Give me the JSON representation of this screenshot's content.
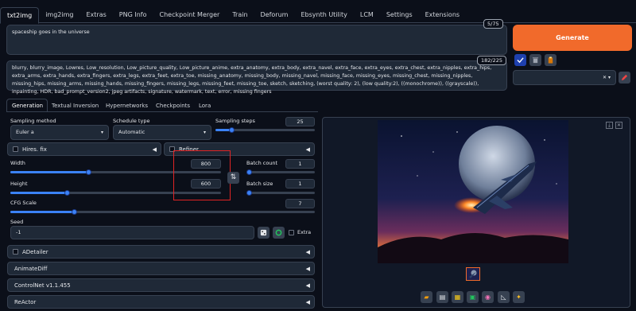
{
  "topnav": [
    "txt2img",
    "img2img",
    "Extras",
    "PNG Info",
    "Checkpoint Merger",
    "Train",
    "Deforum",
    "Ebsynth Utility",
    "LCM",
    "Settings",
    "Extensions"
  ],
  "prompt": {
    "text": "spaceship goes in the universe",
    "counter": "5/75"
  },
  "negative_prompt": {
    "text": "blurry, blurry_image, Lowres, Low_resolution, Low_picture_quality, Low_picture_anime, extra_anatomy, extra_body, extra_navel, extra_face, extra_eyes, extra_chest, extra_nipples, extra_hips, extra_arms, extra_hands, extra_fingers, extra_legs, extra_feet, extra_toe, missing_anatomy, missing_body, missing_navel, missing_face, missing_eyes, missing_chest, missing_nipples, missing_hips, missing_arms, missing_hands, missing_fingers, missing_legs, missing_feet, missing_toe, sketch, sketching, (worst quality: 2), (low quality:2), ((monochrome)), ((grayscale)), inpainting, HDR, bad_prompt_version2, jpeg artifacts, signature, watermark, text, error, missing fingers",
    "counter": "182/225"
  },
  "generate_label": "Generate",
  "subtabs": [
    "Generation",
    "Textual Inversion",
    "Hypernetworks",
    "Checkpoints",
    "Lora"
  ],
  "sampling_method": {
    "label": "Sampling method",
    "value": "Euler a"
  },
  "schedule_type": {
    "label": "Schedule type",
    "value": "Automatic"
  },
  "sampling_steps": {
    "label": "Sampling steps",
    "value": "25",
    "fraction": 0.16
  },
  "hires_label": "Hires. fix",
  "refiner_label": "Refiner",
  "width": {
    "label": "Width",
    "value": "800",
    "fraction": 0.37
  },
  "height": {
    "label": "Height",
    "value": "600",
    "fraction": 0.27
  },
  "batch_count": {
    "label": "Batch count",
    "value": "1",
    "fraction": 0.0
  },
  "batch_size": {
    "label": "Batch size",
    "value": "1",
    "fraction": 0.0
  },
  "cfg_scale": {
    "label": "CFG Scale",
    "value": "7",
    "fraction": 0.21
  },
  "seed": {
    "label": "Seed",
    "value": "-1",
    "extra_label": "Extra"
  },
  "accordions": [
    "ADetailer",
    "AnimateDiff",
    "ControlNet v1.1.455",
    "ReActor"
  ],
  "swap_icon": "⇅",
  "colors": {
    "accent": "#f16a2b",
    "slider": "#3b82f6",
    "highlight": "#e02424"
  }
}
